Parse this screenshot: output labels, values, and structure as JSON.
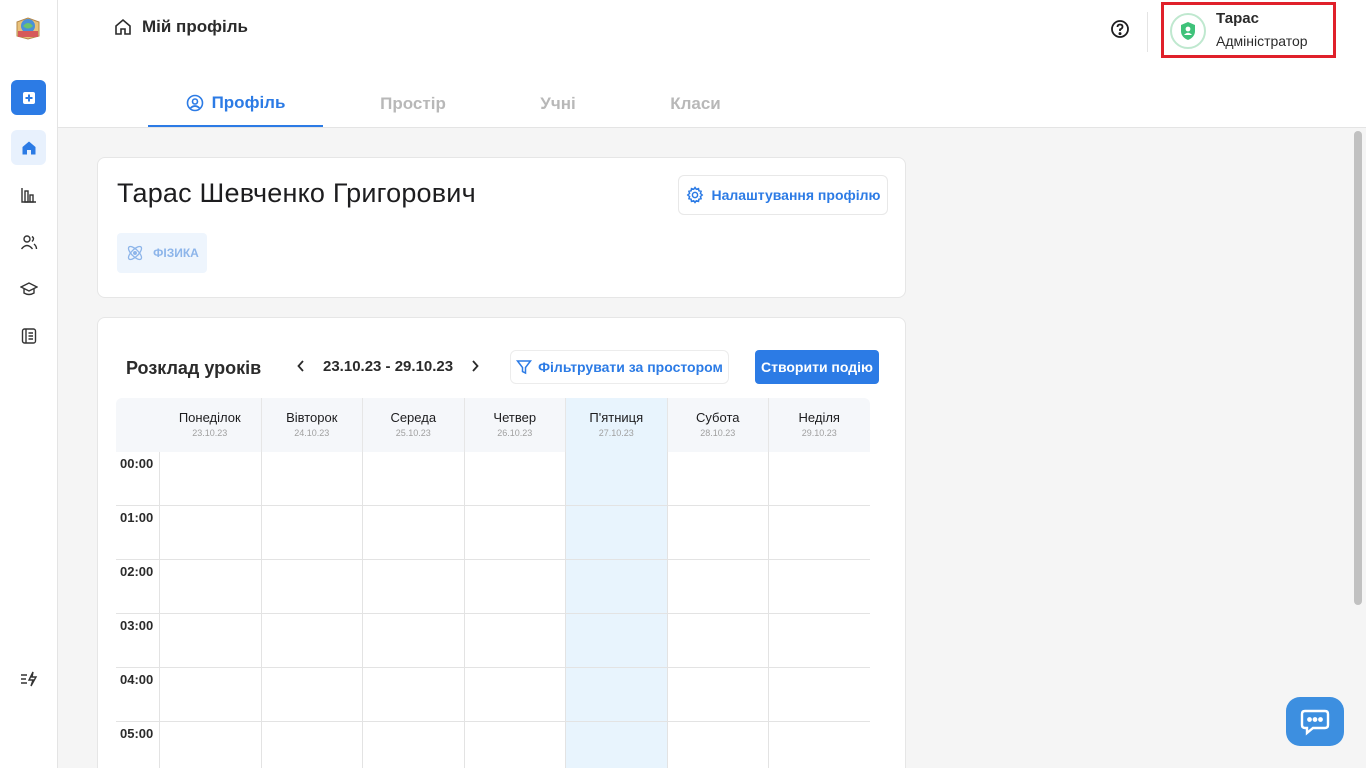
{
  "header": {
    "breadcrumb": "Мій профіль",
    "user": {
      "name": "Тарас",
      "role": "Адміністратор"
    }
  },
  "sidebar": {
    "icons": [
      "app-logo-icon",
      "add-icon",
      "home-icon",
      "analytics-icon",
      "users-icon",
      "graduation-cap-icon",
      "journal-icon",
      "quick-actions-icon"
    ]
  },
  "tabs": [
    {
      "label": "Профіль",
      "active": true
    },
    {
      "label": "Простір",
      "active": false
    },
    {
      "label": "Учні",
      "active": false
    },
    {
      "label": "Класи",
      "active": false
    }
  ],
  "profile": {
    "full_name": "Тарас Шевченко Григорович",
    "settings_label": "Налаштування профілю",
    "subject": "ФІЗИКА"
  },
  "schedule": {
    "title": "Розклад уроків",
    "week_range": "23.10.23 - 29.10.23",
    "filter_label": "Фільтрувати за простором",
    "create_label": "Створити подію",
    "days": [
      {
        "name": "Понеділок",
        "date": "23.10.23"
      },
      {
        "name": "Вівторок",
        "date": "24.10.23"
      },
      {
        "name": "Середа",
        "date": "25.10.23"
      },
      {
        "name": "Четвер",
        "date": "26.10.23"
      },
      {
        "name": "П'ятниця",
        "date": "27.10.23"
      },
      {
        "name": "Субота",
        "date": "28.10.23"
      },
      {
        "name": "Неділя",
        "date": "29.10.23"
      }
    ],
    "highlighted_day": 4,
    "hours": [
      "00:00",
      "01:00",
      "02:00",
      "03:00",
      "04:00",
      "05:00"
    ]
  },
  "colors": {
    "accent": "#2c7be5",
    "highlight_column": "#e8f4fd",
    "user_box_outline": "#e0202a"
  }
}
